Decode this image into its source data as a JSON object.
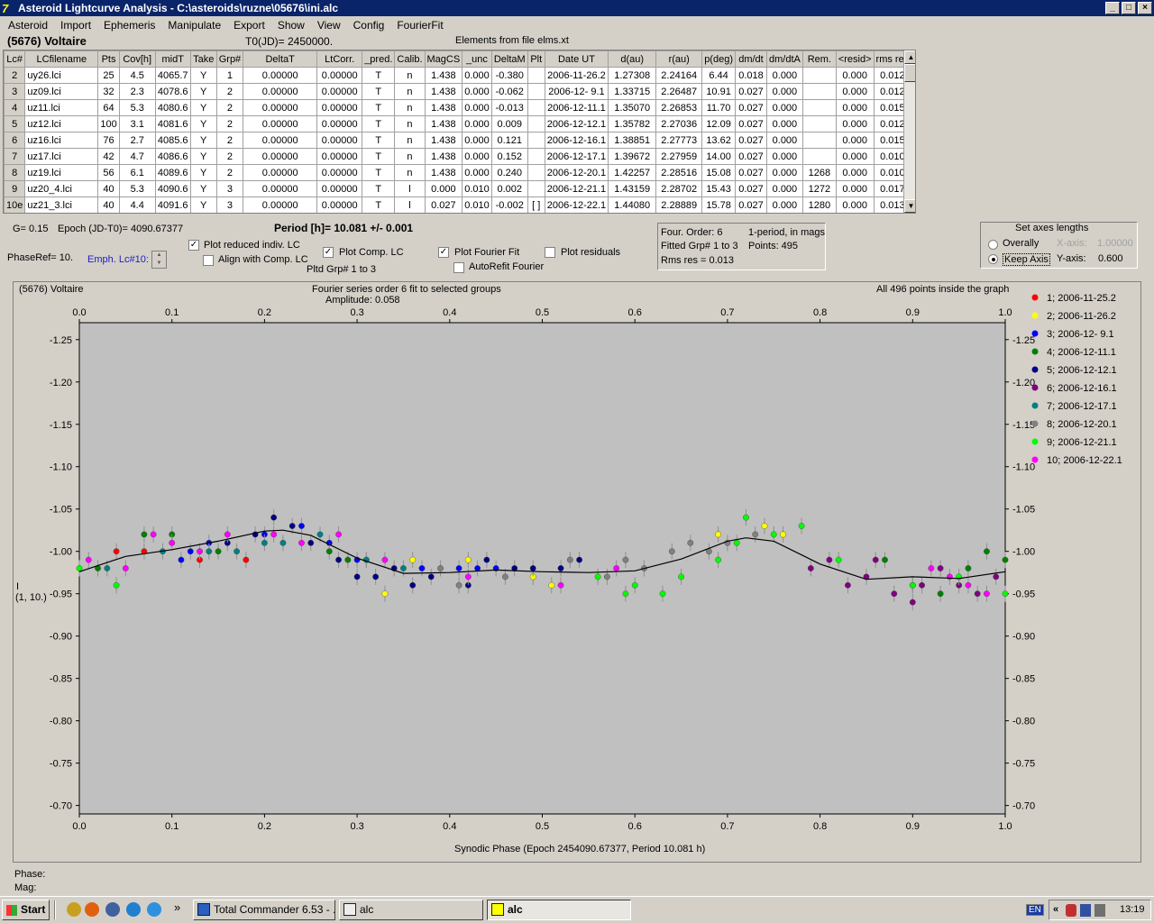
{
  "window": {
    "title": "Asteroid Lightcurve Analysis - C:\\asteroids\\ruzne\\05676\\ini.alc"
  },
  "menu": [
    "Asteroid",
    "Import",
    "Ephemeris",
    "Manipulate",
    "Export",
    "Show",
    "View",
    "Config",
    "FourierFit"
  ],
  "header": {
    "object": "(5676) Voltaire",
    "t0": "T0(JD)= 2450000.",
    "elements": "Elements from file elms.xt"
  },
  "table": {
    "columns": [
      "Lc#",
      "LCfilename",
      "Pts",
      "Cov[h]",
      "midT",
      "Take",
      "Grp#",
      "DeltaT",
      "LtCorr.",
      "_pred.",
      "Calib.",
      "MagCS",
      "_unc",
      "DeltaM",
      "Plt",
      "Date UT",
      "d(au)",
      "r(au)",
      "p(deg)",
      "dm/dt",
      "dm/dtA",
      "Rem.",
      "<resid>",
      "rms res"
    ],
    "rows": [
      [
        "2",
        "uy26.lci",
        "25",
        "4.5",
        "4065.7",
        "Y",
        "1",
        "0.00000",
        "0.00000",
        "T",
        "n",
        "1.438",
        "0.000",
        "-0.380",
        "",
        "2006-11-26.2",
        "1.27308",
        "2.24164",
        "6.44",
        "0.018",
        "0.000",
        "",
        "0.000",
        "0.012"
      ],
      [
        "3",
        "uz09.lci",
        "32",
        "2.3",
        "4078.6",
        "Y",
        "2",
        "0.00000",
        "0.00000",
        "T",
        "n",
        "1.438",
        "0.000",
        "-0.062",
        "",
        "2006-12- 9.1",
        "1.33715",
        "2.26487",
        "10.91",
        "0.027",
        "0.000",
        "",
        "0.000",
        "0.012"
      ],
      [
        "4",
        "uz11.lci",
        "64",
        "5.3",
        "4080.6",
        "Y",
        "2",
        "0.00000",
        "0.00000",
        "T",
        "n",
        "1.438",
        "0.000",
        "-0.013",
        "",
        "2006-12-11.1",
        "1.35070",
        "2.26853",
        "11.70",
        "0.027",
        "0.000",
        "",
        "0.000",
        "0.015"
      ],
      [
        "5",
        "uz12.lci",
        "100",
        "3.1",
        "4081.6",
        "Y",
        "2",
        "0.00000",
        "0.00000",
        "T",
        "n",
        "1.438",
        "0.000",
        "0.009",
        "",
        "2006-12-12.1",
        "1.35782",
        "2.27036",
        "12.09",
        "0.027",
        "0.000",
        "",
        "0.000",
        "0.012"
      ],
      [
        "6",
        "uz16.lci",
        "76",
        "2.7",
        "4085.6",
        "Y",
        "2",
        "0.00000",
        "0.00000",
        "T",
        "n",
        "1.438",
        "0.000",
        "0.121",
        "",
        "2006-12-16.1",
        "1.38851",
        "2.27773",
        "13.62",
        "0.027",
        "0.000",
        "",
        "0.000",
        "0.015"
      ],
      [
        "7",
        "uz17.lci",
        "42",
        "4.7",
        "4086.6",
        "Y",
        "2",
        "0.00000",
        "0.00000",
        "T",
        "n",
        "1.438",
        "0.000",
        "0.152",
        "",
        "2006-12-17.1",
        "1.39672",
        "2.27959",
        "14.00",
        "0.027",
        "0.000",
        "",
        "0.000",
        "0.010"
      ],
      [
        "8",
        "uz19.lci",
        "56",
        "6.1",
        "4089.6",
        "Y",
        "2",
        "0.00000",
        "0.00000",
        "T",
        "n",
        "1.438",
        "0.000",
        "0.240",
        "",
        "2006-12-20.1",
        "1.42257",
        "2.28516",
        "15.08",
        "0.027",
        "0.000",
        "1268",
        "0.000",
        "0.010"
      ],
      [
        "9",
        "uz20_4.lci",
        "40",
        "5.3",
        "4090.6",
        "Y",
        "3",
        "0.00000",
        "0.00000",
        "T",
        "l",
        "0.000",
        "0.010",
        "0.002",
        "",
        "2006-12-21.1",
        "1.43159",
        "2.28702",
        "15.43",
        "0.027",
        "0.000",
        "1272",
        "0.000",
        "0.017"
      ],
      [
        "10e",
        "uz21_3.lci",
        "40",
        "4.4",
        "4091.6",
        "Y",
        "3",
        "0.00000",
        "0.00000",
        "T",
        "l",
        "0.027",
        "0.010",
        "-0.002",
        "[ ]",
        "2006-12-22.1",
        "1.44080",
        "2.28889",
        "15.78",
        "0.027",
        "0.000",
        "1280",
        "0.000",
        "0.013"
      ]
    ]
  },
  "controls": {
    "g": "G= 0.15",
    "epoch": "Epoch (JD-T0)= 4090.67377",
    "period": "Period [h]= 10.081 +/- 0.001",
    "phaseref": "PhaseRef= 10.",
    "emph": "Emph. Lc#10:",
    "plot_reduced": "Plot reduced indiv. LC",
    "align": "Align with Comp. LC",
    "plot_comp": "Plot Comp. LC",
    "pltd_grp": "Pltd Grp#  1  to   3",
    "plot_fourier": "Plot Fourier Fit",
    "autorefit": "AutoRefit Fourier",
    "plot_resid": "Plot residuals",
    "four_order": "Four. Order:  6",
    "one_period": "1-period, in mags",
    "fitted": "Fitted Grp# 1 to 3",
    "points": "Points: 495",
    "rms": "Rms res      = 0.013",
    "axes_title": "Set axes lengths",
    "overally": "Overally",
    "keep": "Keep Axis",
    "xaxis": "X-axis:",
    "xval": "1.00000",
    "yaxis": "Y-axis:",
    "yval": "0.600"
  },
  "graph": {
    "title_left": "(5676) Voltaire",
    "title_center": "Fourier series order 6 fit to selected groups",
    "amplitude": "Amplitude: 0.058",
    "title_right": "All 496 points inside the graph",
    "xlabel": "Synodic Phase (Epoch 2454090.67377, Period 10.081 h)",
    "ylabel1": "I",
    "ylabel2": "(1, 10.)",
    "phase_lbl": "Phase:",
    "mag_lbl": "Mag:"
  },
  "chart_data": {
    "type": "scatter",
    "xlim": [
      0.0,
      1.0
    ],
    "ylim": [
      -1.27,
      -0.69
    ],
    "y_inverted": true,
    "xticks": [
      "0.0",
      "0.1",
      "0.2",
      "0.3",
      "0.4",
      "0.5",
      "0.6",
      "0.7",
      "0.8",
      "0.9",
      "1.0"
    ],
    "yticks": [
      "-1.25",
      "-1.20",
      "-1.15",
      "-1.10",
      "-1.05",
      "-1.00",
      "-0.95",
      "-0.90",
      "-0.85",
      "-0.80",
      "-0.75",
      "-0.70"
    ],
    "legend": [
      {
        "name": "1; 2006-11-25.2",
        "color": "#ff0000"
      },
      {
        "name": "2; 2006-11-26.2",
        "color": "#ffff00"
      },
      {
        "name": "3; 2006-12- 9.1",
        "color": "#0000ff"
      },
      {
        "name": "4; 2006-12-11.1",
        "color": "#008000"
      },
      {
        "name": "5; 2006-12-12.1",
        "color": "#000080"
      },
      {
        "name": "6; 2006-12-16.1",
        "color": "#800080"
      },
      {
        "name": "7; 2006-12-17.1",
        "color": "#008080"
      },
      {
        "name": "8; 2006-12-20.1",
        "color": "#808080"
      },
      {
        "name": "9; 2006-12-21.1",
        "color": "#00ff00"
      },
      {
        "name": "10; 2006-12-22.1",
        "color": "#ff00ff"
      }
    ],
    "fourier_fit": {
      "x": [
        0.0,
        0.05,
        0.1,
        0.15,
        0.2,
        0.22,
        0.25,
        0.3,
        0.35,
        0.4,
        0.45,
        0.5,
        0.55,
        0.6,
        0.65,
        0.7,
        0.72,
        0.75,
        0.8,
        0.85,
        0.9,
        0.95,
        1.0
      ],
      "y": [
        -0.976,
        -0.994,
        -1.002,
        -1.012,
        -1.024,
        -1.025,
        -1.019,
        -0.992,
        -0.974,
        -0.975,
        -0.978,
        -0.976,
        -0.975,
        -0.977,
        -0.991,
        -1.012,
        -1.016,
        -1.012,
        -0.985,
        -0.967,
        -0.97,
        -0.968,
        -0.976
      ]
    },
    "points": [
      {
        "g": 0,
        "x": 0.07,
        "y": -1.0
      },
      {
        "g": 0,
        "x": 0.04,
        "y": -1.0
      },
      {
        "g": 0,
        "x": 0.13,
        "y": -0.99
      },
      {
        "g": 0,
        "x": 0.18,
        "y": -0.99
      },
      {
        "g": 1,
        "x": 0.31,
        "y": -0.99
      },
      {
        "g": 1,
        "x": 0.33,
        "y": -0.95
      },
      {
        "g": 1,
        "x": 0.36,
        "y": -0.99
      },
      {
        "g": 1,
        "x": 0.42,
        "y": -0.99
      },
      {
        "g": 1,
        "x": 0.49,
        "y": -0.97
      },
      {
        "g": 1,
        "x": 0.51,
        "y": -0.96
      },
      {
        "g": 1,
        "x": 0.69,
        "y": -1.02
      },
      {
        "g": 1,
        "x": 0.74,
        "y": -1.03
      },
      {
        "g": 1,
        "x": 0.76,
        "y": -1.02
      },
      {
        "g": 2,
        "x": 0.11,
        "y": -0.99
      },
      {
        "g": 2,
        "x": 0.12,
        "y": -1.0
      },
      {
        "g": 2,
        "x": 0.14,
        "y": -1.01
      },
      {
        "g": 2,
        "x": 0.2,
        "y": -1.02
      },
      {
        "g": 2,
        "x": 0.24,
        "y": -1.03
      },
      {
        "g": 2,
        "x": 0.27,
        "y": -1.01
      },
      {
        "g": 2,
        "x": 0.3,
        "y": -0.99
      },
      {
        "g": 2,
        "x": 0.37,
        "y": -0.98
      },
      {
        "g": 2,
        "x": 0.41,
        "y": -0.98
      },
      {
        "g": 2,
        "x": 0.43,
        "y": -0.98
      },
      {
        "g": 2,
        "x": 0.45,
        "y": -0.98
      },
      {
        "g": 3,
        "x": 0.02,
        "y": -0.98
      },
      {
        "g": 3,
        "x": 0.07,
        "y": -1.02
      },
      {
        "g": 3,
        "x": 0.1,
        "y": -1.02
      },
      {
        "g": 3,
        "x": 0.15,
        "y": -1.0
      },
      {
        "g": 3,
        "x": 0.27,
        "y": -1.0
      },
      {
        "g": 3,
        "x": 0.29,
        "y": -0.99
      },
      {
        "g": 3,
        "x": 0.87,
        "y": -0.99
      },
      {
        "g": 3,
        "x": 0.9,
        "y": -0.96
      },
      {
        "g": 3,
        "x": 0.93,
        "y": -0.95
      },
      {
        "g": 3,
        "x": 0.96,
        "y": -0.98
      },
      {
        "g": 3,
        "x": 0.98,
        "y": -1.0
      },
      {
        "g": 3,
        "x": 1.0,
        "y": -0.99
      },
      {
        "g": 4,
        "x": 0.16,
        "y": -1.01
      },
      {
        "g": 4,
        "x": 0.19,
        "y": -1.02
      },
      {
        "g": 4,
        "x": 0.21,
        "y": -1.04
      },
      {
        "g": 4,
        "x": 0.23,
        "y": -1.03
      },
      {
        "g": 4,
        "x": 0.25,
        "y": -1.01
      },
      {
        "g": 4,
        "x": 0.28,
        "y": -0.99
      },
      {
        "g": 4,
        "x": 0.3,
        "y": -0.97
      },
      {
        "g": 4,
        "x": 0.32,
        "y": -0.97
      },
      {
        "g": 4,
        "x": 0.34,
        "y": -0.98
      },
      {
        "g": 4,
        "x": 0.38,
        "y": -0.97
      },
      {
        "g": 4,
        "x": 0.42,
        "y": -0.96
      },
      {
        "g": 4,
        "x": 0.44,
        "y": -0.99
      },
      {
        "g": 4,
        "x": 0.47,
        "y": -0.98
      },
      {
        "g": 4,
        "x": 0.49,
        "y": -0.98
      },
      {
        "g": 4,
        "x": 0.52,
        "y": -0.98
      },
      {
        "g": 4,
        "x": 0.54,
        "y": -0.99
      },
      {
        "g": 4,
        "x": 0.36,
        "y": -0.96
      },
      {
        "g": 5,
        "x": 0.79,
        "y": -0.98
      },
      {
        "g": 5,
        "x": 0.81,
        "y": -0.99
      },
      {
        "g": 5,
        "x": 0.83,
        "y": -0.96
      },
      {
        "g": 5,
        "x": 0.85,
        "y": -0.97
      },
      {
        "g": 5,
        "x": 0.88,
        "y": -0.95
      },
      {
        "g": 5,
        "x": 0.91,
        "y": -0.96
      },
      {
        "g": 5,
        "x": 0.93,
        "y": -0.98
      },
      {
        "g": 5,
        "x": 0.95,
        "y": -0.96
      },
      {
        "g": 5,
        "x": 0.97,
        "y": -0.95
      },
      {
        "g": 5,
        "x": 0.99,
        "y": -0.97
      },
      {
        "g": 5,
        "x": 0.86,
        "y": -0.99
      },
      {
        "g": 5,
        "x": 0.9,
        "y": -0.94
      },
      {
        "g": 6,
        "x": 0.03,
        "y": -0.98
      },
      {
        "g": 6,
        "x": 0.09,
        "y": -1.0
      },
      {
        "g": 6,
        "x": 0.14,
        "y": -1.0
      },
      {
        "g": 6,
        "x": 0.17,
        "y": -1.0
      },
      {
        "g": 6,
        "x": 0.2,
        "y": -1.01
      },
      {
        "g": 6,
        "x": 0.22,
        "y": -1.01
      },
      {
        "g": 6,
        "x": 0.26,
        "y": -1.02
      },
      {
        "g": 6,
        "x": 0.31,
        "y": -0.99
      },
      {
        "g": 6,
        "x": 0.35,
        "y": -0.98
      },
      {
        "g": 7,
        "x": 0.39,
        "y": -0.98
      },
      {
        "g": 7,
        "x": 0.41,
        "y": -0.96
      },
      {
        "g": 7,
        "x": 0.46,
        "y": -0.97
      },
      {
        "g": 7,
        "x": 0.53,
        "y": -0.99
      },
      {
        "g": 7,
        "x": 0.57,
        "y": -0.97
      },
      {
        "g": 7,
        "x": 0.59,
        "y": -0.99
      },
      {
        "g": 7,
        "x": 0.61,
        "y": -0.98
      },
      {
        "g": 7,
        "x": 0.64,
        "y": -1.0
      },
      {
        "g": 7,
        "x": 0.66,
        "y": -1.01
      },
      {
        "g": 7,
        "x": 0.68,
        "y": -1.0
      },
      {
        "g": 7,
        "x": 0.7,
        "y": -1.01
      },
      {
        "g": 7,
        "x": 0.73,
        "y": -1.02
      },
      {
        "g": 8,
        "x": 0.0,
        "y": -0.98
      },
      {
        "g": 8,
        "x": 0.04,
        "y": -0.96
      },
      {
        "g": 8,
        "x": 0.56,
        "y": -0.97
      },
      {
        "g": 8,
        "x": 0.6,
        "y": -0.96
      },
      {
        "g": 8,
        "x": 0.63,
        "y": -0.95
      },
      {
        "g": 8,
        "x": 0.65,
        "y": -0.97
      },
      {
        "g": 8,
        "x": 0.69,
        "y": -0.99
      },
      {
        "g": 8,
        "x": 0.71,
        "y": -1.01
      },
      {
        "g": 8,
        "x": 0.72,
        "y": -1.04
      },
      {
        "g": 8,
        "x": 0.75,
        "y": -1.02
      },
      {
        "g": 8,
        "x": 0.78,
        "y": -1.03
      },
      {
        "g": 8,
        "x": 0.82,
        "y": -0.99
      },
      {
        "g": 8,
        "x": 0.9,
        "y": -0.96
      },
      {
        "g": 8,
        "x": 0.95,
        "y": -0.97
      },
      {
        "g": 8,
        "x": 1.0,
        "y": -0.95
      },
      {
        "g": 8,
        "x": 0.59,
        "y": -0.95
      },
      {
        "g": 9,
        "x": 0.01,
        "y": -0.99
      },
      {
        "g": 9,
        "x": 0.05,
        "y": -0.98
      },
      {
        "g": 9,
        "x": 0.08,
        "y": -1.02
      },
      {
        "g": 9,
        "x": 0.1,
        "y": -1.01
      },
      {
        "g": 9,
        "x": 0.13,
        "y": -1.0
      },
      {
        "g": 9,
        "x": 0.16,
        "y": -1.02
      },
      {
        "g": 9,
        "x": 0.21,
        "y": -1.02
      },
      {
        "g": 9,
        "x": 0.24,
        "y": -1.01
      },
      {
        "g": 9,
        "x": 0.28,
        "y": -1.02
      },
      {
        "g": 9,
        "x": 0.33,
        "y": -0.99
      },
      {
        "g": 9,
        "x": 0.42,
        "y": -0.97
      },
      {
        "g": 9,
        "x": 0.52,
        "y": -0.96
      },
      {
        "g": 9,
        "x": 0.58,
        "y": -0.98
      },
      {
        "g": 9,
        "x": 0.92,
        "y": -0.98
      },
      {
        "g": 9,
        "x": 0.94,
        "y": -0.97
      },
      {
        "g": 9,
        "x": 0.96,
        "y": -0.96
      },
      {
        "g": 9,
        "x": 0.98,
        "y": -0.95
      }
    ]
  },
  "taskbar": {
    "start": "Start",
    "tasks": [
      "Total Commander 6.53 - ...",
      "alc",
      "alc"
    ],
    "lang": "EN",
    "time": "13:19"
  },
  "colors": {
    "titlebar": "#0a246a",
    "plot_bg": "#c0c0c0",
    "chrome": "#d4d0c8"
  }
}
